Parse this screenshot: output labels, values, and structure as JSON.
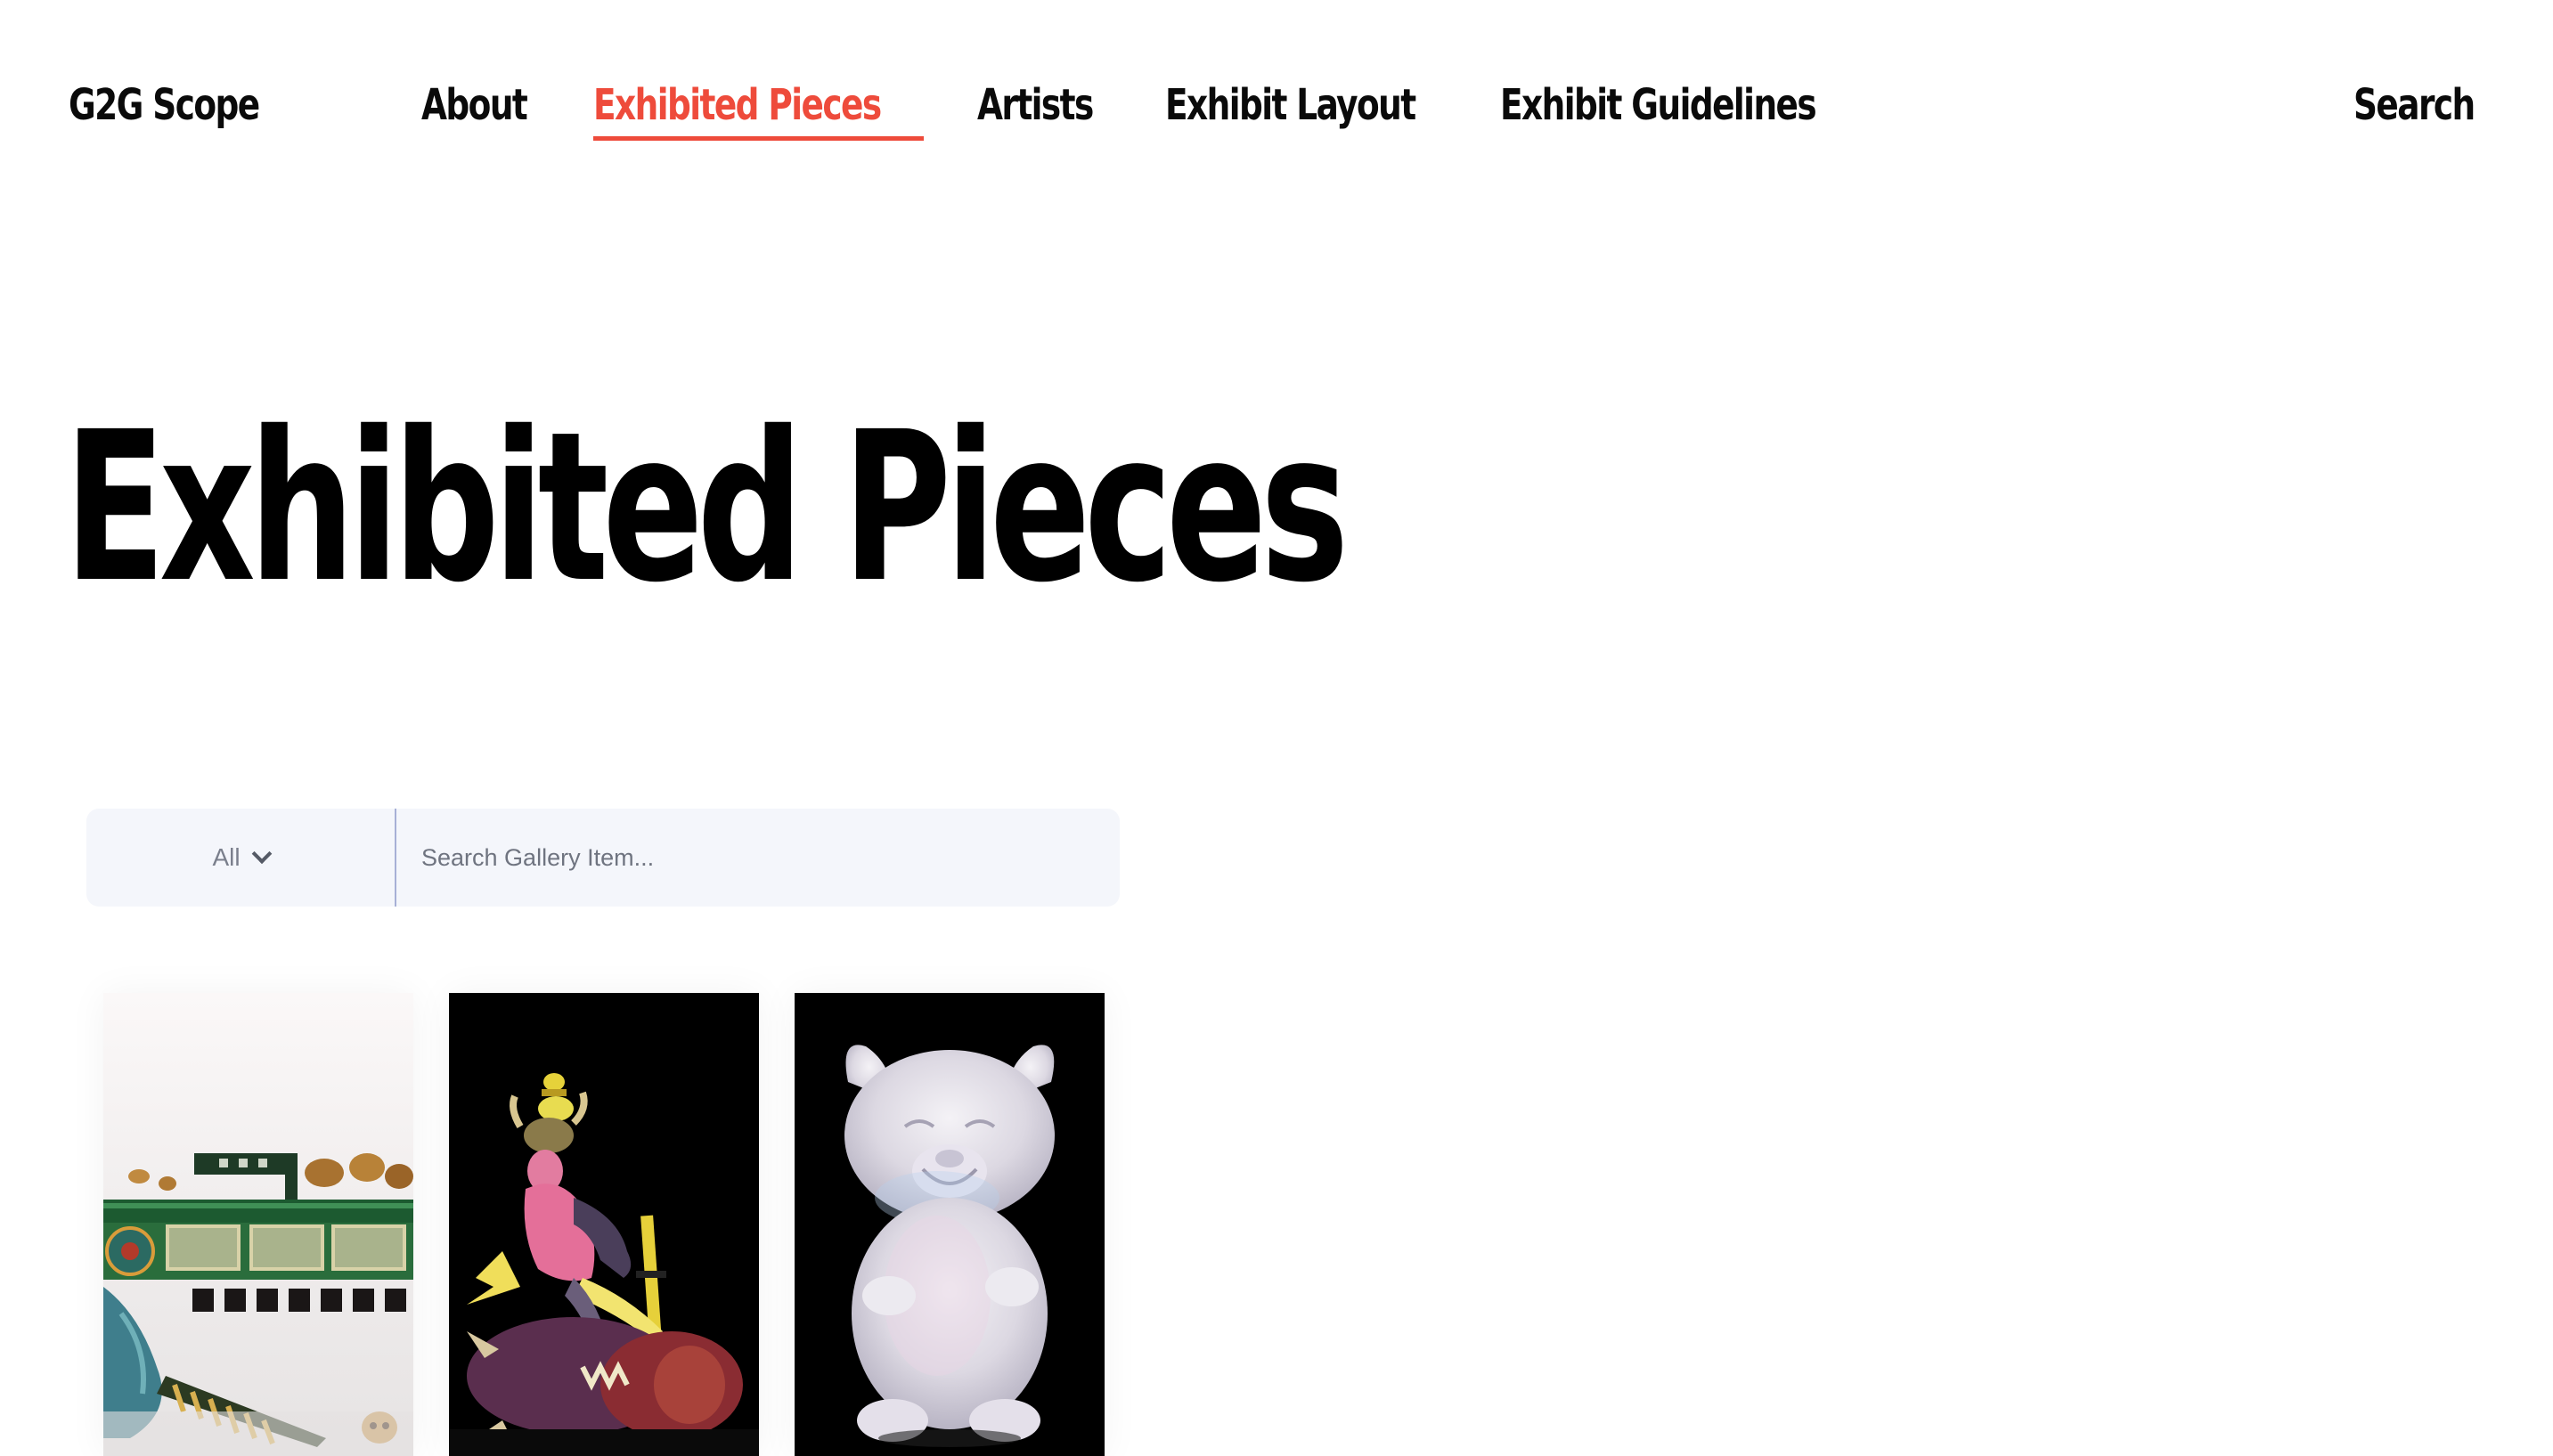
{
  "nav": {
    "brand": "G2G Scope",
    "items": [
      {
        "label": "About"
      },
      {
        "label": "Exhibited Pieces"
      },
      {
        "label": "Artists"
      },
      {
        "label": "Exhibit Layout"
      },
      {
        "label": "Exhibit Guidelines"
      }
    ],
    "active_item": "Exhibited Pieces",
    "search_label": "Search",
    "accent_color": "#ee4b3b"
  },
  "page": {
    "title": "Exhibited Pieces"
  },
  "filter": {
    "selected_category": "All",
    "search_placeholder": "Search Gallery Item...",
    "search_value": ""
  },
  "gallery": {
    "items": [
      {
        "icon": "green-glass-sculpture-image"
      },
      {
        "icon": "warrior-glass-sculpture-image"
      },
      {
        "icon": "bulldog-glass-sculpture-image"
      }
    ]
  }
}
